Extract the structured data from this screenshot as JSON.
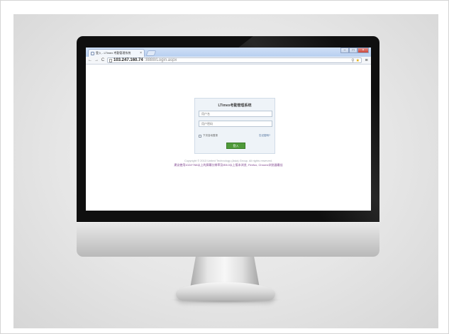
{
  "browser": {
    "tab_title": "登入 - LTimex 考勤管理系统",
    "tab_close": "×",
    "url_host": "103.247.160.74",
    "url_path": ":8888/Login.aspx",
    "back_icon": "←",
    "forward_icon": "→",
    "reload_icon": "C",
    "menu_icon": "≡",
    "win_min": "–",
    "win_max": "□",
    "win_close": "×"
  },
  "login": {
    "title": "LTimex考勤管理系统",
    "username_placeholder": "用户名",
    "password_placeholder": "用户密码",
    "remember_label": "下次自动登录",
    "forgot_label": "忘记密码?",
    "submit_label": "登入"
  },
  "footer": {
    "copyright": "Copyright © 2013 United Technology (Asia) Group. All rights reserved.",
    "notice": "建议使用1024*768以上的屏幕分辨率及IE8.0以上版本浏览, Firefox, Chrome浏览器最佳"
  },
  "colors": {
    "login_button": "#4f9a3a",
    "titlebar": "#b8cff0"
  }
}
